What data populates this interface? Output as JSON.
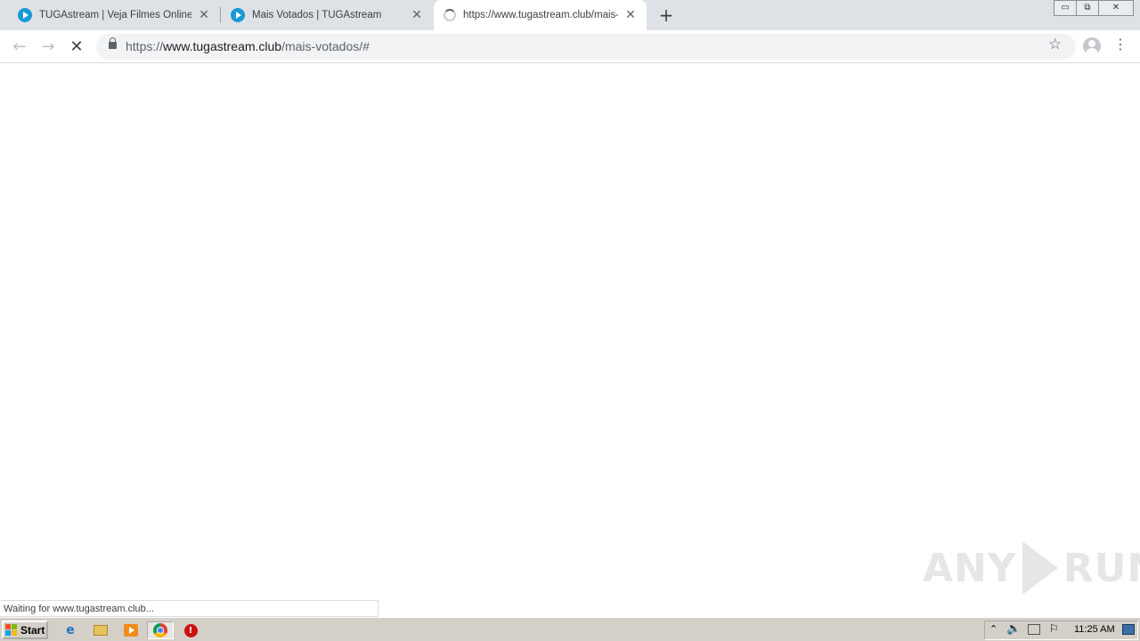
{
  "tabs": [
    {
      "title": "TUGAstream | Veja Filmes Online Leg",
      "state": "loaded"
    },
    {
      "title": "Mais Votados | TUGAstream",
      "state": "loaded"
    },
    {
      "title": "https://www.tugastream.club/mais-v",
      "state": "loading"
    }
  ],
  "newtab_label": "+",
  "window_controls": {
    "minimize": "▭",
    "restore": "⧉",
    "close": "✕"
  },
  "address": {
    "scheme": "https://",
    "host": "www.tugastream.club",
    "path": "/mais-votados/#"
  },
  "status_text": "Waiting for www.tugastream.club...",
  "watermark": {
    "left": "ANY",
    "right": "RUN"
  },
  "taskbar": {
    "start_label": "Start",
    "clock": "11:25 AM"
  },
  "colors": {
    "tabstrip": "#dee1e6",
    "favicon": "#1a9ad6",
    "taskbar": "#d4d0c8"
  }
}
